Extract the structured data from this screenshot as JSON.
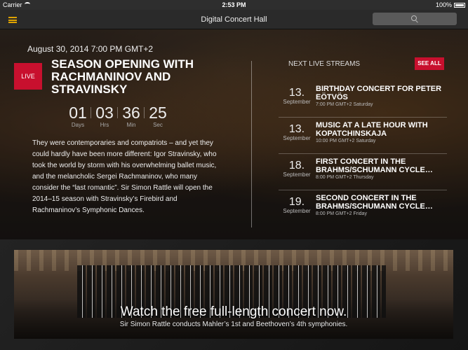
{
  "status_bar": {
    "carrier": "Carrier",
    "time": "2:53 PM",
    "battery": "100%"
  },
  "nav": {
    "title": "Digital Concert Hall"
  },
  "featured": {
    "date": "August 30, 2014 7:00 PM GMT+2",
    "live_label": "LIVE",
    "title": "Season opening with Rachmaninov and Stravinsky",
    "countdown": [
      {
        "value": "01",
        "label": "Days"
      },
      {
        "value": "03",
        "label": "Hrs"
      },
      {
        "value": "36",
        "label": "Min"
      },
      {
        "value": "25",
        "label": "Sec"
      }
    ],
    "description": "They were contemporaries and compatriots – and yet they could hardly have been more different: Igor Stravinsky, who took the world by storm with his overwhelming ballet music, and the melancholic Sergei Rachmaninov, who many consider the “last romantic”. Sir Simon Rattle will open the 2014–15 season with Stravinsky’s Firebird and Rachmaninov’s Symphonic Dances."
  },
  "live_streams": {
    "heading": "NEXT LIVE STREAMS",
    "see_all": "SEE ALL",
    "items": [
      {
        "day": "13.",
        "month": "September",
        "title": "Birthday concert for Peter Eötvös",
        "time": "7:00 PM GMT+2 Saturday"
      },
      {
        "day": "13.",
        "month": "September",
        "title": "Music at a late hour with Kopatchinskaja",
        "time": "10:00 PM GMT+2 Saturday"
      },
      {
        "day": "18.",
        "month": "September",
        "title": "First concert in the Brahms/Schumann Cycle…",
        "time": "8:00 PM GMT+2 Thursday"
      },
      {
        "day": "19.",
        "month": "September",
        "title": "Second concert in the Brahms/Schumann Cycle…",
        "time": "8:00 PM GMT+2 Friday"
      }
    ]
  },
  "promo": {
    "title": "Watch the free full-length concert now.",
    "subtitle": "Sir Simon Rattle conducts Mahler’s 1st and Beethoven’s 4th symphonies."
  },
  "colors": {
    "accent_red": "#c8102e",
    "menu_yellow": "#e0a400"
  },
  "icons": [
    "wifi-icon",
    "battery-icon",
    "menu-icon",
    "search-icon"
  ]
}
